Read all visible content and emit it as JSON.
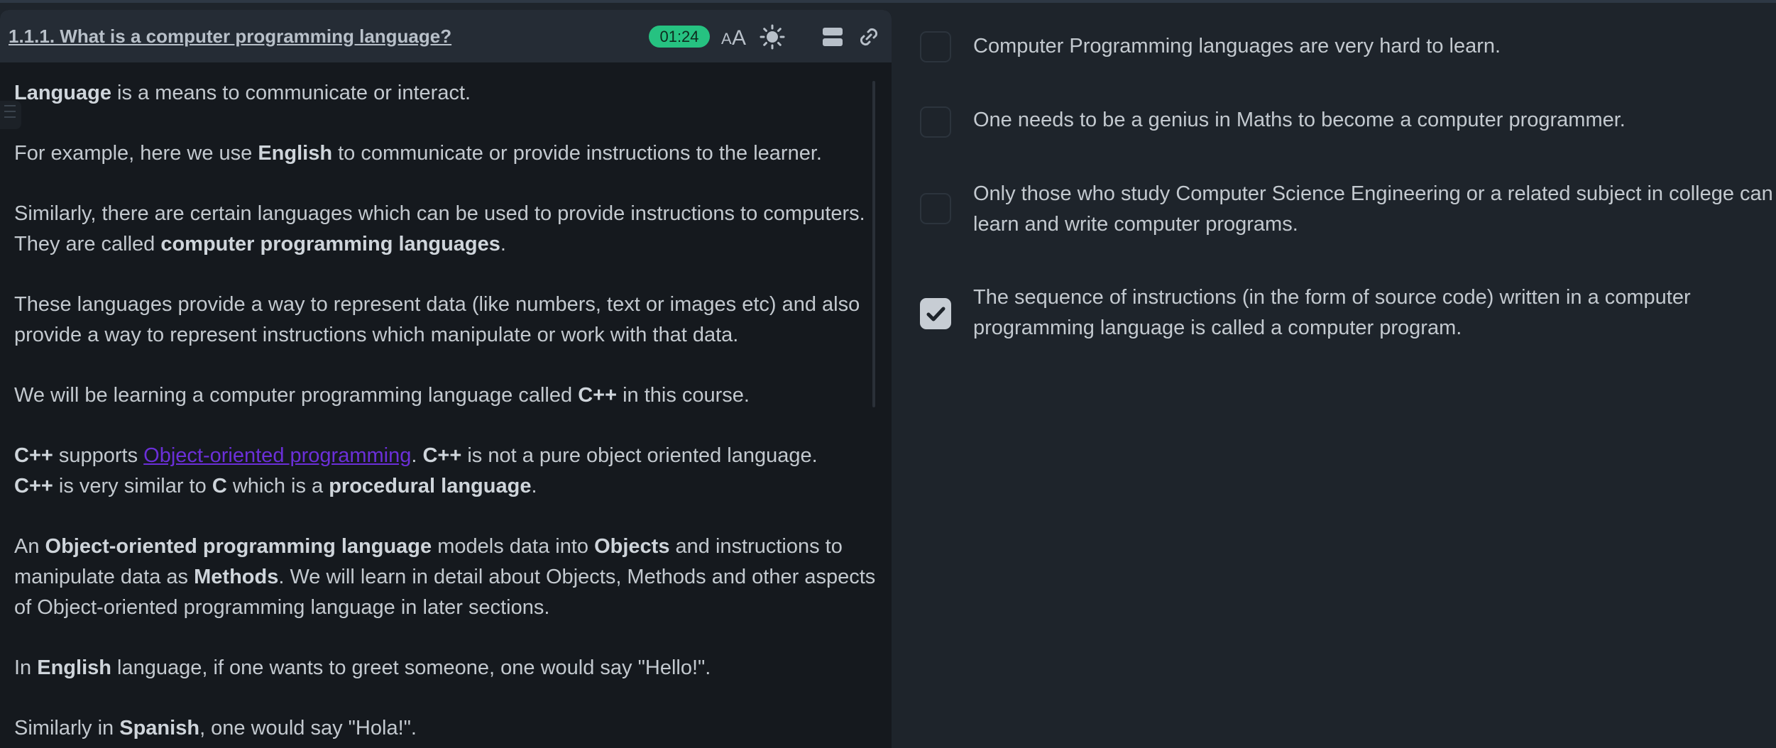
{
  "header": {
    "title": "1.1.1. What is a computer programming language?",
    "timer": "01:24",
    "icons": [
      "font-size-icon",
      "theme-sun-icon",
      "layout-icon",
      "link-icon"
    ]
  },
  "content": {
    "p1": {
      "b1": "Language",
      "t1": " is a means to communicate or interact."
    },
    "p2": {
      "t1": "For example, here we use ",
      "b1": "English",
      "t2": " to communicate or provide instructions to the learner."
    },
    "p3": {
      "t1": "Similarly, there are certain languages which can be used to provide instructions to computers. They are called ",
      "b1": "computer programming languages",
      "t2": "."
    },
    "p4": {
      "t1": "These languages provide a way to represent data (like numbers, text or images etc) and also provide a way to represent instructions which manipulate or work with that data."
    },
    "p5": {
      "t1": "We will be learning a computer programming language called ",
      "b1": "C++",
      "t2": " in this course."
    },
    "p6": {
      "b1": "C++",
      "t1": " supports ",
      "link": "Object-oriented programming",
      "t2": ". ",
      "b2": "C++",
      "t3": " is not a pure object oriented language.",
      "b3": "C++",
      "t4": " is very similar to ",
      "b4": "C",
      "t5": " which is a ",
      "b5": "procedural language",
      "t6": "."
    },
    "p7": {
      "t1": "An ",
      "b1": "Object-oriented programming language",
      "t2": " models data into ",
      "b2": "Objects",
      "t3": " and instructions to manipulate data as ",
      "b3": "Methods",
      "t4": ". We will learn in detail about Objects, Methods and other aspects of Object-oriented programming language in later sections."
    },
    "p8": {
      "t1": "In ",
      "b1": "English",
      "t2": " language, if one wants to greet someone, one would say \"Hello!\"."
    },
    "p9": {
      "t1": "Similarly in ",
      "b1": "Spanish",
      "t2": ", one would say \"Hola!\"."
    }
  },
  "options": [
    {
      "text": "Computer Programming languages are very hard to learn.",
      "checked": false
    },
    {
      "text": "One needs to be a genius in Maths to become a computer programmer.",
      "checked": false
    },
    {
      "text": "Only those who study Computer Science Engineering or a related subject in college can learn and write computer programs.",
      "checked": false
    },
    {
      "text": "The sequence of instructions (in the form of source code) written in a computer programming language is called a computer program.",
      "checked": true
    }
  ],
  "colors": {
    "timer_bg": "#26c281",
    "link": "#6b2fd8",
    "panel_bg": "#15191e",
    "page_bg": "#1e242b"
  }
}
